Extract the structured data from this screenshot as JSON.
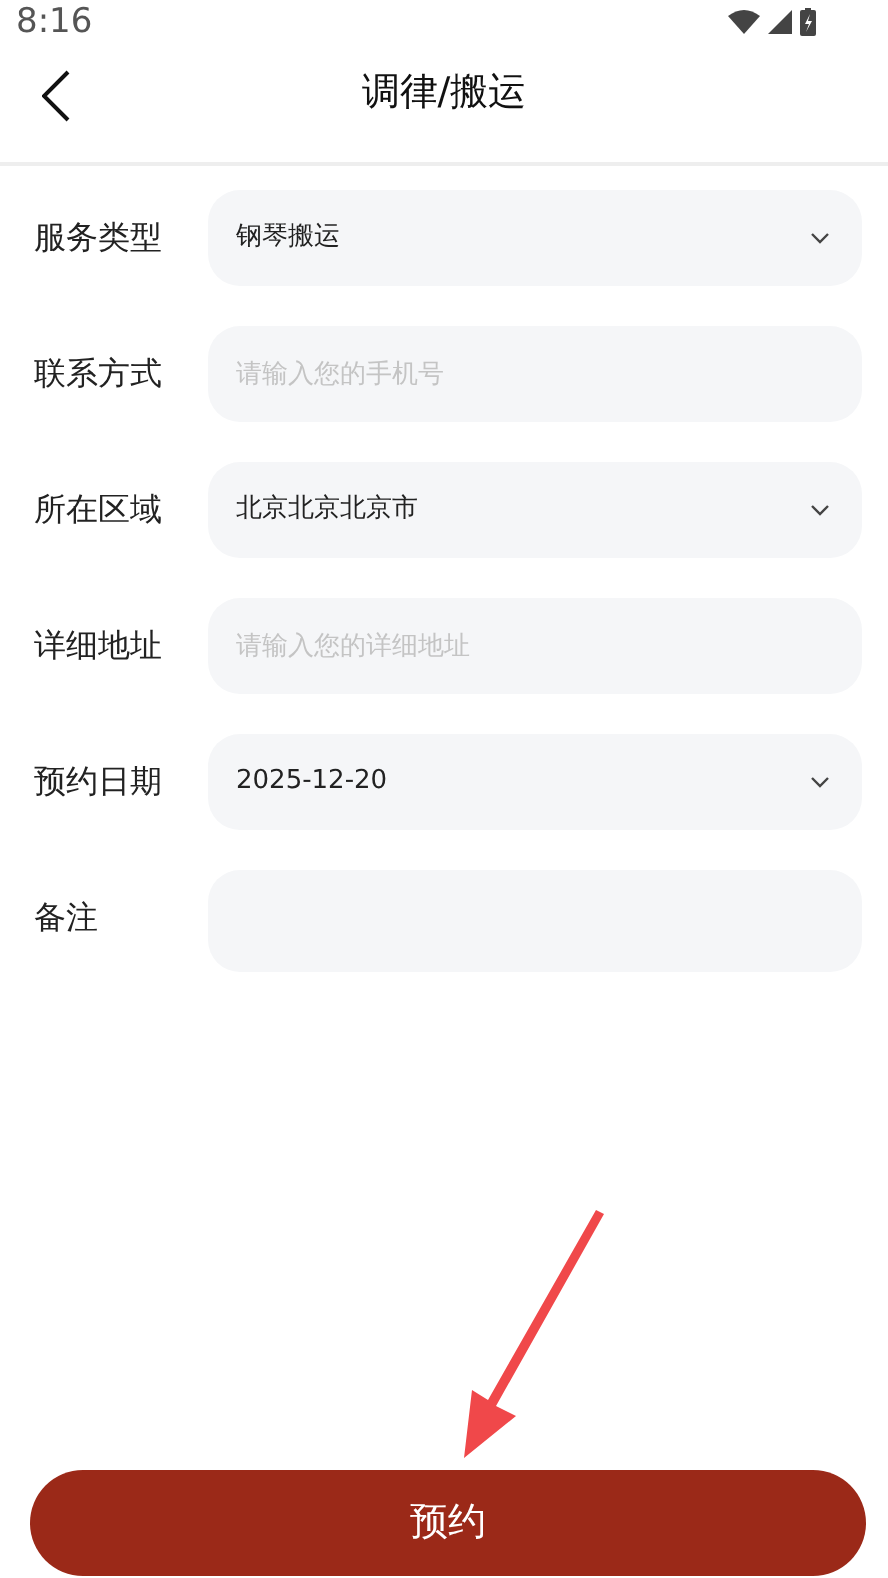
{
  "status_bar": {
    "time": "8:16"
  },
  "header": {
    "title": "调律/搬运"
  },
  "fields": [
    {
      "label": "服务类型",
      "kind": "select",
      "value": "钢琴搬运"
    },
    {
      "label": "联系方式",
      "kind": "input",
      "placeholder": "请输入您的手机号"
    },
    {
      "label": "所在区域",
      "kind": "select",
      "value": "北京北京北京市"
    },
    {
      "label": "详细地址",
      "kind": "input",
      "placeholder": "请输入您的详细地址"
    },
    {
      "label": "预约日期",
      "kind": "select",
      "value": "2025-12-20"
    },
    {
      "label": "备注",
      "kind": "textarea"
    }
  ],
  "submit_button": {
    "label": "预约"
  }
}
